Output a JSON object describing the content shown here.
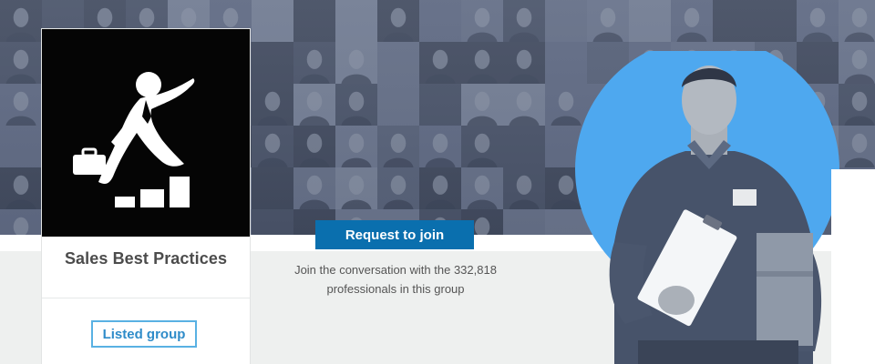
{
  "group": {
    "name": "Sales Best Practices",
    "listed_label": "Listed group"
  },
  "cta": {
    "button_label": "Request to join",
    "description_line1": "Join the conversation with the 332,818",
    "description_line2": "professionals in this group"
  },
  "colors": {
    "primary_button": "#0a6fae",
    "listed_border": "#59b1e3",
    "circle": "#4ea8ef",
    "hero": "#59657b"
  },
  "icons": {
    "logo": "businessman-climbing-bar-chart",
    "badge": "delivery-man-with-clipboard"
  }
}
